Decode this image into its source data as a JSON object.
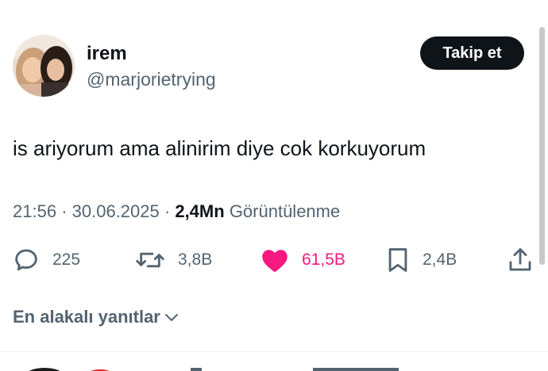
{
  "tweet": {
    "author": {
      "name": "irem",
      "handle": "@marjorietrying"
    },
    "follow_label": "Takip et",
    "text": "is ariyorum ama alinirim diye cok korkuyorum",
    "time": "21:56",
    "date": "30.06.2025",
    "views_count": "2,4Mn",
    "views_label": "Görüntülenme",
    "separator": "·"
  },
  "actions": {
    "replies": "225",
    "reposts": "3,8B",
    "likes": "61,5B",
    "bookmarks": "2,4B"
  },
  "replies_filter": {
    "label": "En alakalı yanıtlar"
  },
  "icons": {
    "reply": "reply-icon",
    "repost": "repost-icon",
    "like": "heart-filled-icon",
    "bookmark": "bookmark-icon",
    "share": "share-icon",
    "chevron": "chevron-down-icon"
  },
  "colors": {
    "text_primary": "#0f1419",
    "text_secondary": "#536471",
    "like_pink": "#f91880",
    "button_bg": "#0f1419",
    "divider": "#eff3f4"
  }
}
